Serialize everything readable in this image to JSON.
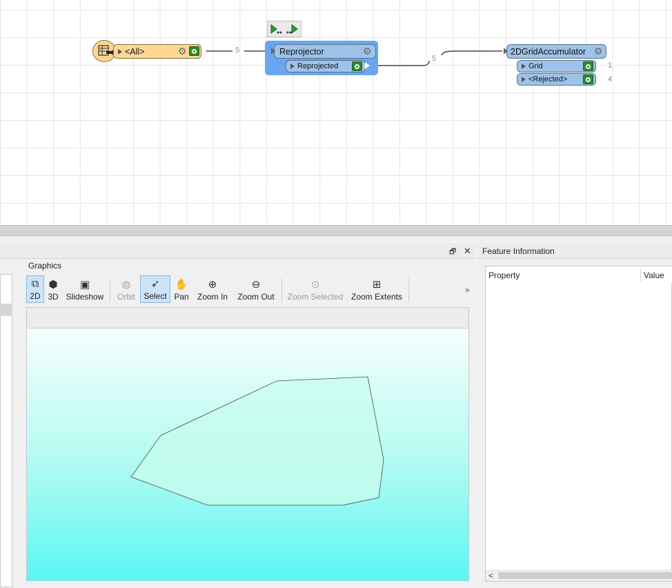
{
  "workflow": {
    "reader": {
      "port_label": "<All>",
      "count": "5"
    },
    "reprojector": {
      "name": "Reprojector",
      "port_label": "Reprojected",
      "count": "5"
    },
    "accumulator": {
      "name": "2DGridAccumulator",
      "ports": [
        {
          "label": "Grid",
          "count": "1"
        },
        {
          "label": "<Rejected>",
          "count": "4"
        }
      ]
    },
    "run_buttons": [
      "run-to-this-icon",
      "run-from-this-icon"
    ]
  },
  "graphics": {
    "title": "Graphics",
    "toolbar": {
      "btn_2d": "2D",
      "btn_3d": "3D",
      "btn_slideshow": "Slideshow",
      "btn_orbit": "Orbit",
      "btn_select": "Select",
      "btn_pan": "Pan",
      "btn_zoom_in": "Zoom In",
      "btn_zoom_out": "Zoom Out",
      "btn_zoom_selected": "Zoom Selected",
      "btn_zoom_extents": "Zoom Extents",
      "overflow": "»"
    },
    "window_controls": {
      "restore": "🗗",
      "close": "✕"
    }
  },
  "feature_info": {
    "title": "Feature Information",
    "columns": {
      "property": "Property",
      "value": "Value"
    },
    "scroll_left": "<"
  },
  "colors": {
    "transformer_fill": "#9ec3ea",
    "selected_fill": "#6aa6ee",
    "reader_fill": "#fdd793",
    "polygon_fill": "#c8fcee"
  }
}
